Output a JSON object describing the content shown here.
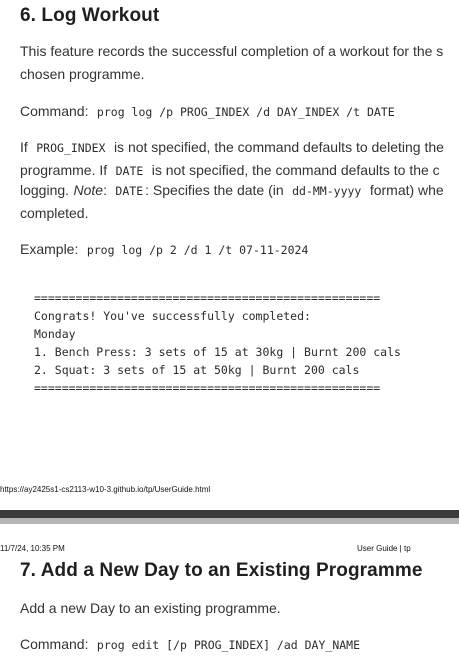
{
  "section6": {
    "heading": "6. Log Workout",
    "desc_line1": "This feature records the successful completion of a workout for the s",
    "desc_line2": "chosen programme.",
    "command_label": "Command:",
    "command_code": "prog log /p PROG_INDEX /d DAY_INDEX /t DATE",
    "note_if1": "If",
    "note_code1": "PROG_INDEX",
    "note_text1": "is not specified, the command defaults to deleting the",
    "note_text2a": "programme. If",
    "note_code2": "DATE",
    "note_text2b": "is not specified, the command defaults to the c",
    "note_text3a": "logging.",
    "note_note": "Note",
    "note_colon": ":",
    "note_code3": "DATE",
    "note_text3b": ": Specifies the date (in",
    "note_code4": "dd-MM-yyyy",
    "note_text3c": "format) whe",
    "note_text4": "completed.",
    "example_label": "Example:",
    "example_code": "prog log /p 2 /d 1 /t 07-11-2024",
    "output_lines": [
      "==================================================",
      "Congrats! You've successfully completed:",
      "Monday",
      "1. Bench Press: 3 sets of 15 at 30kg | Burnt 200 cals",
      "2. Squat: 3 sets of 15 at 50kg | Burnt 200 cals",
      "=================================================="
    ]
  },
  "footer": {
    "url": "https://ay2425s1-cs2113-w10-3.github.io/tp/UserGuide.html"
  },
  "next_page_header": {
    "datetime": "11/7/24, 10:35 PM",
    "title": "User Guide | tp"
  },
  "section7": {
    "heading": "7. Add a New Day to an Existing Programme",
    "desc": "Add a new Day to an existing programme.",
    "command_label": "Command:",
    "command_code": "prog edit [/p PROG_INDEX] /ad DAY_NAME"
  }
}
